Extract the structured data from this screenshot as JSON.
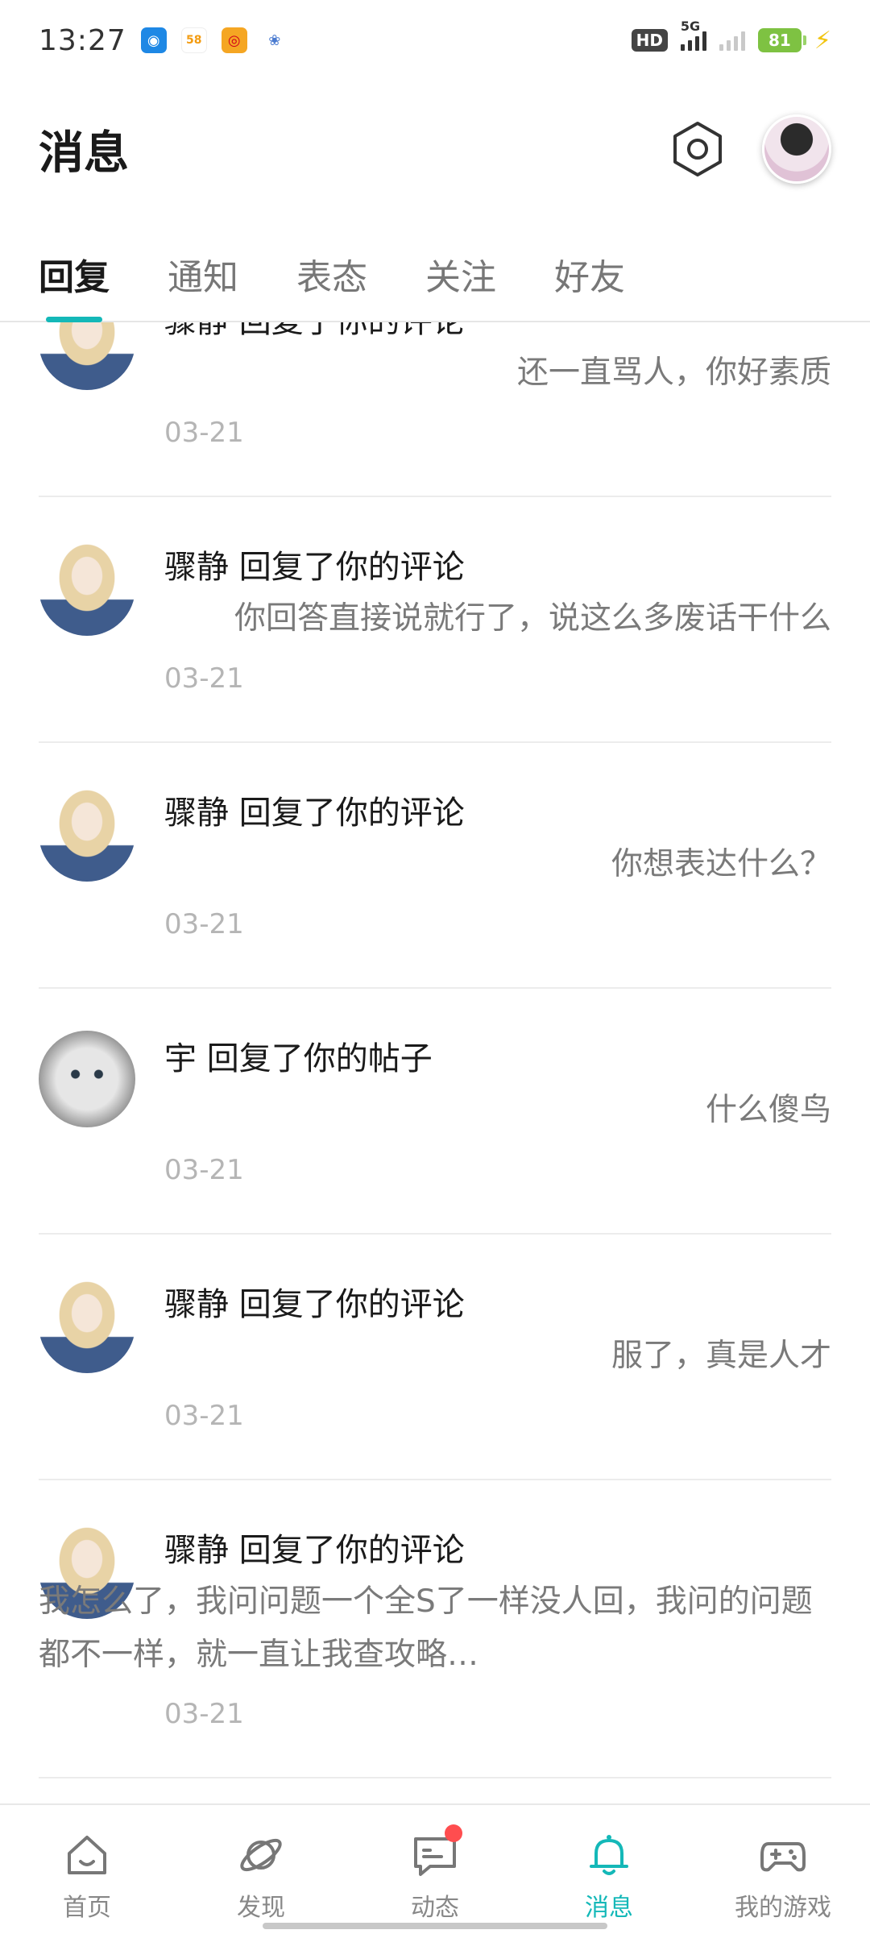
{
  "status_bar": {
    "time": "13:27",
    "battery": "81",
    "network": "5G",
    "hd": "HD"
  },
  "header": {
    "title": "消息"
  },
  "tabs": [
    {
      "label": "回复",
      "active": true
    },
    {
      "label": "通知",
      "active": false
    },
    {
      "label": "表态",
      "active": false
    },
    {
      "label": "关注",
      "active": false
    },
    {
      "label": "好友",
      "active": false
    }
  ],
  "messages": [
    {
      "title": "骤静 回复了你的评论",
      "body": "还一直骂人，你好素质",
      "date": "03-21",
      "avatar": "anime-girl-avatar"
    },
    {
      "title": "骤静 回复了你的评论",
      "body": "你回答直接说就行了，说这么多废话干什么",
      "date": "03-21",
      "avatar": "anime-girl-avatar"
    },
    {
      "title": "骤静 回复了你的评论",
      "body": "你想表达什么？",
      "date": "03-21",
      "avatar": "anime-girl-avatar"
    },
    {
      "title": "宇 回复了你的帖子",
      "body": "什么傻鸟",
      "date": "03-21",
      "avatar": "cat-avatar"
    },
    {
      "title": "骤静 回复了你的评论",
      "body": "服了，真是人才",
      "date": "03-21",
      "avatar": "anime-girl-avatar"
    },
    {
      "title": "骤静 回复了你的评论",
      "body": "我怎么了，我问问题一个全S了一样没人回，我问的问题都不一样，就一直让我查攻略…",
      "date": "03-21",
      "avatar": "anime-girl-avatar"
    }
  ],
  "bottom_nav": [
    {
      "label": "首页",
      "icon": "home-icon",
      "active": false
    },
    {
      "label": "发现",
      "icon": "planet-icon",
      "active": false
    },
    {
      "label": "动态",
      "icon": "chat-bubble-icon",
      "active": false,
      "badge": true
    },
    {
      "label": "消息",
      "icon": "bell-icon",
      "active": true
    },
    {
      "label": "我的游戏",
      "icon": "gamepad-icon",
      "active": false
    }
  ],
  "colors": {
    "accent": "#14b8b8",
    "badge": "#ff4d4f"
  }
}
